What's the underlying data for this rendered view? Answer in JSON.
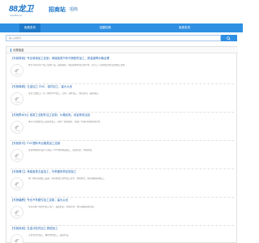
{
  "header": {
    "logo_text": "88龙卫",
    "logo_sub": "www.88lw.com",
    "site_name": "招商站",
    "site_tag": "招商"
  },
  "nav": {
    "items": [
      {
        "label": "免费发布"
      },
      {
        "label": "加盟招商"
      },
      {
        "label": "免费发布"
      }
    ]
  },
  "search": {
    "placeholder": "输入关键词",
    "button_icon": "search-icon"
  },
  "list": {
    "heading": "分类信息",
    "items": [
      {
        "title": "【东莞厚街】专业厚街加工定制，承接各类汽车内饰配件加工，质量保障价格合理",
        "desc": "本公司专业生产加工各类产品，品质保障，欢迎来电咨询洽谈合作，实力工厂货源充足支持定制加工服务。"
      },
      {
        "title": "【东莞南城】五金加工 CNC、铝件加工，量大从优",
        "desc": "专业五金加工厂家，精密CNC加工，铝件、铜件加工，交货及时，品质保证。"
      },
      {
        "title": "【东莞樟木头】各类工业配件加工定制，价格优惠，欢迎来电洽谈",
        "desc": "本公司主要经营工业配件加工，提供一站式服务，欢迎广大客户来电咨询合作。"
      },
      {
        "title": "【东莞常平】PVC塑料专业模具加工定制",
        "desc": "专业塑料模具设计与制造，PVC塑料制品加工，质量可靠，价格优惠。"
      },
      {
        "title": "【东莞黄江】承接各类五金加工，可来图来样定制加工",
        "desc": "本厂拥有先进加工设备，承接各类五金件加工业务，交期准时，欢迎来图来样加工。"
      },
      {
        "title": "【东莞塘厦】专业汽车配件加工定制，量大从优",
        "desc": "专业从事汽车配件加工生产，品质稳定，价格合理，支持来图来样定制。"
      },
      {
        "title": "【东莞凤岗】五金冲压件加工 精密加工",
        "desc": "五金冲压件加工，精密零件加工，品质优良。"
      }
    ]
  }
}
